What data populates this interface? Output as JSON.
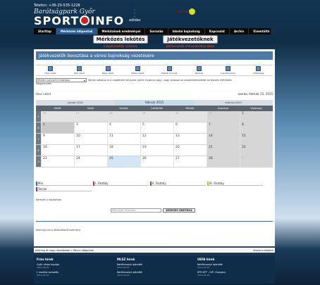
{
  "header": {
    "phone": "Telefon: +36-20-535-1228",
    "subtitle": "Barátságpark Győr",
    "brand_left": "SPORT",
    "brand_right": "INFO",
    "adidas": "adidas",
    "tennis": "tennis"
  },
  "nav": [
    {
      "label": "Starttap"
    },
    {
      "label": "Mérkőzés időpontok"
    },
    {
      "label": "Mérkőzések eredményei"
    },
    {
      "label": "Sorsolás"
    },
    {
      "label": "Iskolai bajnokság"
    },
    {
      "label": "Kapcsolat"
    },
    {
      "label": "Archív"
    },
    {
      "label": "Üzemtöltő"
    }
  ],
  "promo": {
    "left_label": "Mérkőzés lekötés",
    "left_sub": "Csapatvezetők számára",
    "right_label": "Játékvezetőknek",
    "right_sub": "Játékvezetők lemondásához ablak"
  },
  "main": {
    "title": "Játékvezetők beosztása a városi bajnokság vezetésére",
    "tools": [
      "Havi nézet",
      "Heti nézet",
      "Napi nézet",
      "Hetes nézet",
      "Naptár kivonat",
      "Keresés",
      "Lapozás előre",
      "Időbeliség"
    ],
    "filter_select": "Minden helyszín mutatása",
    "filter_text": "Kérjük válasszi ki a megfelelő helyszínt amire kíváncsi vagy, vagy válasszi az alapértelmezettet az összes mérkőzés",
    "all_link": "Megjelenítés",
    "view_label": "Havi nézet",
    "current_date": "szerda, február 25, 2015",
    "months": [
      "január 2015",
      "február 2015",
      "március 2015"
    ],
    "dow": [
      "Hétfő",
      "Kedd",
      "Szerda",
      "Csütörtök",
      "Péntek",
      "Szombat",
      "Vasárnap"
    ],
    "weeks": [
      {
        "wk": "5",
        "days": [
          "26",
          "27",
          "28",
          "29",
          "30",
          "31",
          "1"
        ]
      },
      {
        "wk": "6",
        "days": [
          "2",
          "3",
          "4",
          "5",
          "6",
          "7",
          "8"
        ]
      },
      {
        "wk": "7",
        "days": [
          "9",
          "10",
          "11",
          "12",
          "13",
          "14",
          "15"
        ]
      },
      {
        "wk": "8",
        "days": [
          "16",
          "17",
          "18",
          "19",
          "20",
          "21",
          "22"
        ]
      },
      {
        "wk": "9",
        "days": [
          "23",
          "24",
          "25",
          "26",
          "27",
          "28",
          "1"
        ]
      }
    ],
    "legend": [
      {
        "label": "Mix",
        "color": "#1f66c2"
      },
      {
        "label": "I. Osztály",
        "color": "#d52a2a"
      },
      {
        "label": "II. Osztály",
        "color": "#2a8a2a"
      },
      {
        "label": "III. Osztály",
        "color": "#d6b21e"
      },
      {
        "label": "Senior",
        "color": "#7a2fa0"
      }
    ],
    "search_label": "Keresés a naptárban",
    "search_placeholder": "Mérkőzés keresése...",
    "search_button": "KERESÉS INDÍTÁSA",
    "no_event": "Jelenleg nincs elkövetkező esemény"
  },
  "bottom": {
    "left": "Jelenleg itt vagy: Kezdőoldal » Meccs időpontok",
    "right": "Vissza a tetejére"
  },
  "footer": [
    {
      "title": "Friss hírek",
      "items": [
        {
          "t": "Győr város kupája",
          "d": "2014-03-25"
        },
        {
          "t": "I. osztály sorsolás",
          "d": "2014-02-10"
        }
      ]
    },
    {
      "title": "MLSZ hírek",
      "items": [
        {
          "t": "Kerékcsonyi ajándék",
          "d": "2014-03-25"
        },
        {
          "t": "Kerékcsonyi ajándék",
          "d": "2014-03-18"
        }
      ]
    },
    {
      "title": "UEFA hírek",
      "items": [
        {
          "t": "Kerékcsonyi ajándék",
          "d": "2014-03-25"
        },
        {
          "t": "KTS KFT - IVP- Hungary",
          "d": "2014-03-18"
        }
      ]
    }
  ]
}
